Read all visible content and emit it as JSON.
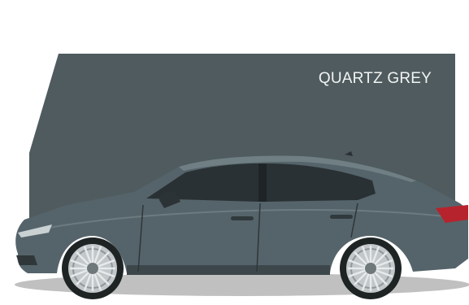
{
  "swatch": {
    "label": "QUARTZ GREY",
    "color": "#4f5b5e",
    "label_color": "#f2f4f4"
  },
  "vehicle": {
    "type": "sedan",
    "view": "side-profile",
    "body_color": "#55646a",
    "glass_color": "#2a3134",
    "tail_light_color": "#b7232c"
  }
}
